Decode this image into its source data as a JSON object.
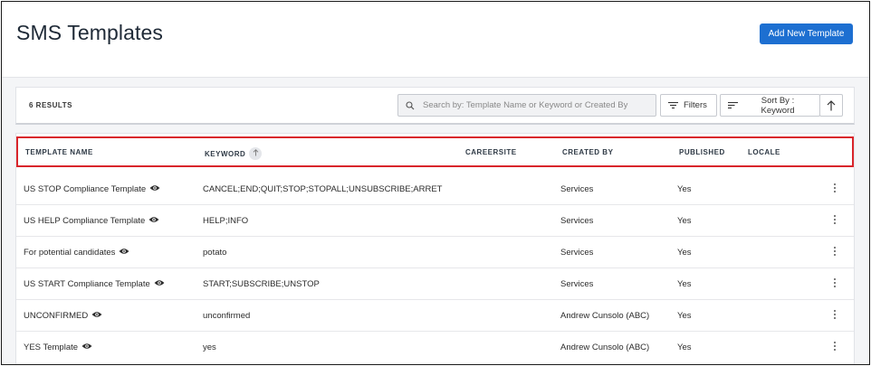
{
  "header": {
    "title": "SMS Templates",
    "add_button": "Add New Template"
  },
  "toolbar": {
    "results": "6 RESULTS",
    "search_placeholder": "Search by: Template Name or Keyword or Created By",
    "filters_label": "Filters",
    "sort_label": "Sort By : Keyword",
    "sort_direction": "ascending"
  },
  "table": {
    "columns": {
      "template_name": "TEMPLATE NAME",
      "keyword": "KEYWORD",
      "careersite": "CAREERSITE",
      "created_by": "CREATED BY",
      "published": "PUBLISHED",
      "locale": "LOCALE"
    },
    "rows": [
      {
        "name": "US STOP Compliance Template",
        "keyword": "CANCEL;END;QUIT;STOP;STOPALL;UNSUBSCRIBE;ARRET",
        "careersite": "",
        "created_by": "Services",
        "published": "Yes",
        "locale": ""
      },
      {
        "name": "US HELP Compliance Template",
        "keyword": "HELP;INFO",
        "careersite": "",
        "created_by": "Services",
        "published": "Yes",
        "locale": ""
      },
      {
        "name": "For potential candidates",
        "keyword": "potato",
        "careersite": "",
        "created_by": "Services",
        "published": "Yes",
        "locale": ""
      },
      {
        "name": "US START Compliance Template",
        "keyword": "START;SUBSCRIBE;UNSTOP",
        "careersite": "",
        "created_by": "Services",
        "published": "Yes",
        "locale": ""
      },
      {
        "name": "UNCONFIRMED",
        "keyword": "unconfirmed",
        "careersite": "",
        "created_by": "Andrew Cunsolo (ABC)",
        "published": "Yes",
        "locale": ""
      },
      {
        "name": "YES Template",
        "keyword": "yes",
        "careersite": "",
        "created_by": "Andrew Cunsolo (ABC)",
        "published": "Yes",
        "locale": ""
      }
    ]
  },
  "icons": {
    "search": "search-icon",
    "filters": "filter-lines-icon",
    "sort": "sort-lines-icon",
    "sort_direction": "arrow-up-icon",
    "preview": "eye-icon",
    "row_menu": "kebab-menu-icon"
  },
  "colors": {
    "primary": "#1d6fd1",
    "highlight_border": "#d9252b"
  }
}
